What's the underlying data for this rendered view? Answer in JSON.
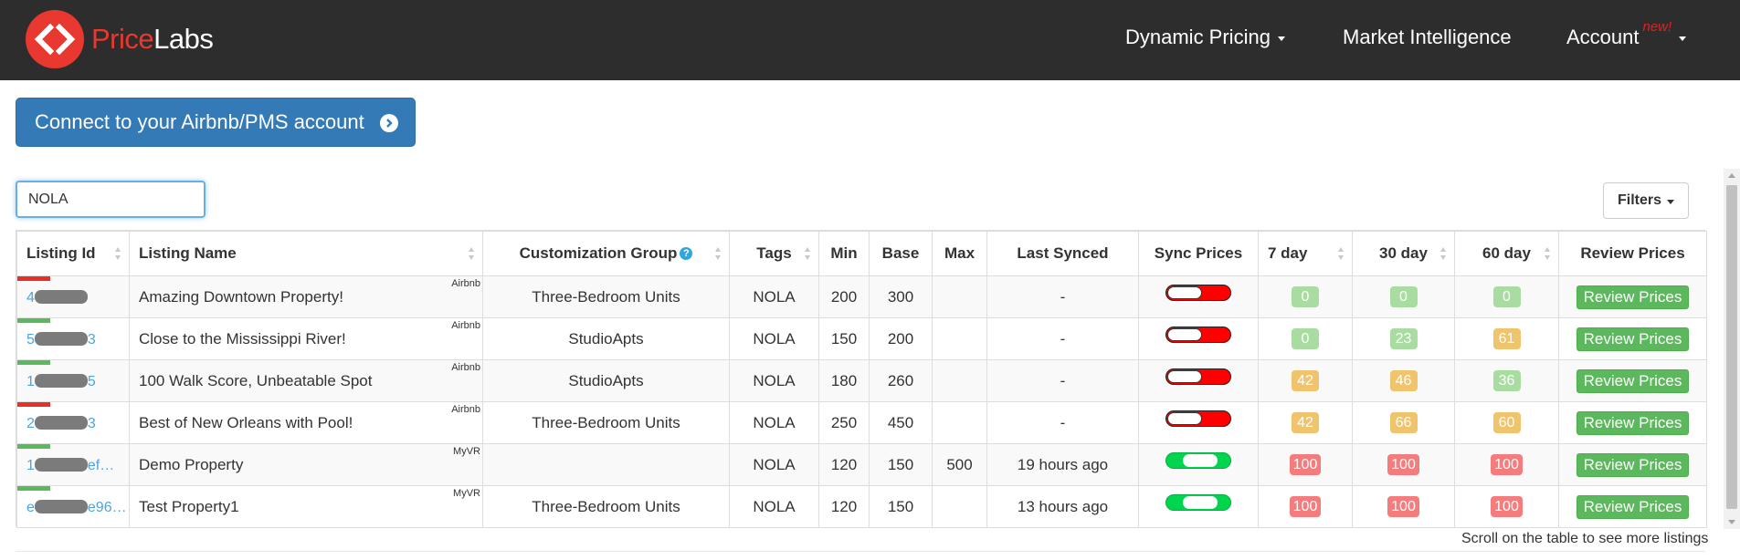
{
  "nav": {
    "logo_part1": "Price",
    "logo_part2": "Labs",
    "dynamic_pricing": "Dynamic Pricing",
    "market_intelligence": "Market Intelligence",
    "account": "Account",
    "account_badge": "new!"
  },
  "connect_button": "Connect to your Airbnb/PMS account",
  "search": {
    "value": "NOLA"
  },
  "filters_label": "Filters",
  "table": {
    "headers": {
      "listing_id": "Listing Id",
      "listing_name": "Listing Name",
      "customization_group": "Customization Group",
      "tags": "Tags",
      "min": "Min",
      "base": "Base",
      "max": "Max",
      "last_synced": "Last Synced",
      "sync_prices": "Sync Prices",
      "d7": "7 day",
      "d30": "30 day",
      "d60": "60 day",
      "review_prices": "Review Prices"
    },
    "rows": [
      {
        "id_prefix": "4",
        "id_suffix": "",
        "id_bar_color": "#e5302a",
        "name": "Amazing Downtown Property!",
        "source": "Airbnb",
        "group": "Three-Bedroom Units",
        "tags": "NOLA",
        "min": "200",
        "base": "300",
        "max": "",
        "last_synced": "-",
        "sync_on": false,
        "d7": "0",
        "d30": "0",
        "d60": "0",
        "d7_color": "#a9dca1",
        "d30_color": "#a9dca1",
        "d60_color": "#a9dca1",
        "review": "Review Prices"
      },
      {
        "id_prefix": "5",
        "id_suffix": "3",
        "id_bar_color": "#5cb85c",
        "name": "Close to the Mississippi River!",
        "source": "Airbnb",
        "group": "StudioApts",
        "tags": "NOLA",
        "min": "150",
        "base": "200",
        "max": "",
        "last_synced": "-",
        "sync_on": false,
        "d7": "0",
        "d30": "23",
        "d60": "61",
        "d7_color": "#a9dca1",
        "d30_color": "#a9dca1",
        "d60_color": "#f0c36d",
        "review": "Review Prices"
      },
      {
        "id_prefix": "1",
        "id_suffix": "5",
        "id_bar_color": "#5cb85c",
        "name": "100 Walk Score, Unbeatable Spot",
        "source": "Airbnb",
        "group": "StudioApts",
        "tags": "NOLA",
        "min": "180",
        "base": "260",
        "max": "",
        "last_synced": "-",
        "sync_on": false,
        "d7": "42",
        "d30": "46",
        "d60": "36",
        "d7_color": "#f0c36d",
        "d30_color": "#f0c36d",
        "d60_color": "#a9dca1",
        "review": "Review Prices"
      },
      {
        "id_prefix": "2",
        "id_suffix": "3",
        "id_bar_color": "#e5302a",
        "name": "Best of New Orleans with Pool!",
        "source": "Airbnb",
        "group": "Three-Bedroom Units",
        "tags": "NOLA",
        "min": "250",
        "base": "450",
        "max": "",
        "last_synced": "-",
        "sync_on": false,
        "d7": "42",
        "d30": "66",
        "d60": "60",
        "d7_color": "#f0c36d",
        "d30_color": "#f0c36d",
        "d60_color": "#f0c36d",
        "review": "Review Prices"
      },
      {
        "id_prefix": "1",
        "id_suffix": "ef…",
        "id_bar_color": "#5cb85c",
        "name": "Demo Property",
        "source": "MyVR",
        "group": "",
        "tags": "NOLA",
        "min": "120",
        "base": "150",
        "max": "500",
        "last_synced": "19 hours ago",
        "sync_on": true,
        "d7": "100",
        "d30": "100",
        "d60": "100",
        "d7_color": "#f47c7c",
        "d30_color": "#f47c7c",
        "d60_color": "#f47c7c",
        "review": "Review Prices"
      },
      {
        "id_prefix": "e",
        "id_suffix": "e96…",
        "id_bar_color": "#5cb85c",
        "name": "Test Property1",
        "source": "MyVR",
        "group": "Three-Bedroom Units",
        "tags": "NOLA",
        "min": "120",
        "base": "150",
        "max": "",
        "last_synced": "13 hours ago",
        "sync_on": true,
        "d7": "100",
        "d30": "100",
        "d60": "100",
        "d7_color": "#f47c7c",
        "d30_color": "#f47c7c",
        "d60_color": "#f47c7c",
        "review": "Review Prices"
      }
    ]
  },
  "footer_note": "Scroll on the table to see more listings"
}
